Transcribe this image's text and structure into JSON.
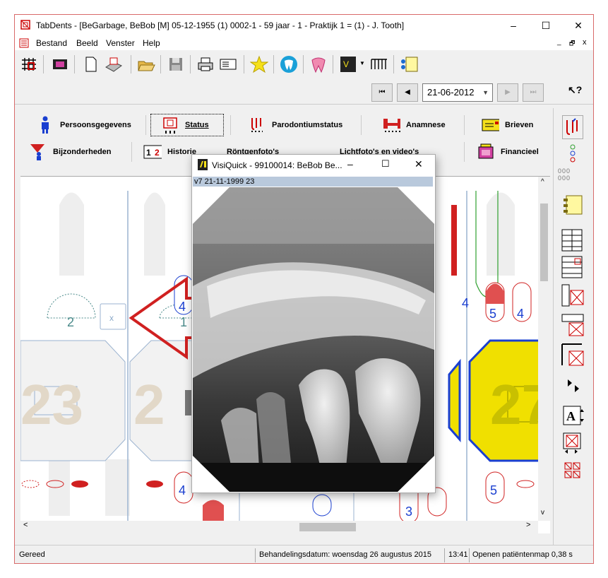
{
  "window": {
    "title": "TabDents - [BeGarbage, BeBob [M] 05-12-1955 (1) 0002-1 - 59 jaar - 1 - Praktijk 1 = (1) - J. Tooth]",
    "minimize": "–",
    "maximize": "☐",
    "close": "✕"
  },
  "menu": {
    "items": [
      "Bestand",
      "Beeld",
      "Venster",
      "Help"
    ],
    "mdi_min": "_",
    "mdi_restore": "🗗",
    "mdi_close": "x"
  },
  "navigation": {
    "date": "21-06-2012",
    "first": "⏮",
    "prev": "◀",
    "next": "▶",
    "last": "⏭"
  },
  "tabs": {
    "row1": [
      "Persoonsgegevens",
      "Status",
      "Parodontiumstatus",
      "Anamnese",
      "Brieven"
    ],
    "row2": [
      "Bijzonderheden",
      "Historie",
      "Röntgenfoto's",
      "Lichtfoto's en video's",
      "Financieel"
    ]
  },
  "chart": {
    "tooth_numbers": [
      "23",
      "2",
      "27"
    ],
    "labels": [
      "2",
      "1",
      "4",
      "4",
      "5",
      "4",
      "4",
      "5",
      "3",
      "x"
    ]
  },
  "popup": {
    "title": "VisiQuick - 99100014: BeBob Be...",
    "info": "v7  21-11-1999  23",
    "minimize": "–",
    "maximize": "☐",
    "close": "✕"
  },
  "statusbar": {
    "ready": "Gereed",
    "treatment_date": "Behandelingsdatum: woensdag 26 augustus 2015",
    "time": "13:41",
    "message": "Openen patiëntenmap 0,38 s"
  },
  "colors": {
    "accent_red": "#d02020",
    "accent_blue": "#1a3fd0",
    "yellow": "#f0e000",
    "green": "#30a030"
  }
}
